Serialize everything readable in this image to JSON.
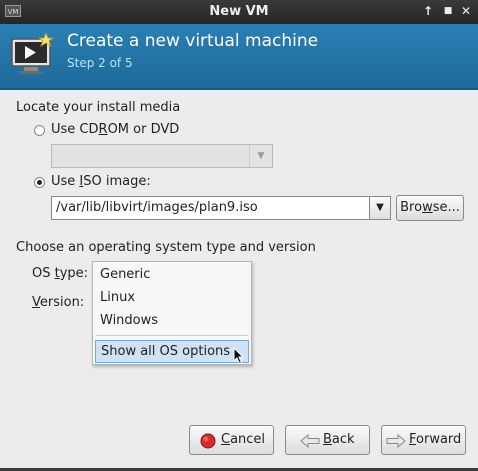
{
  "window": {
    "title": "New VM",
    "app_icon_text": "VM",
    "btn_up": "↑",
    "btn_max": "■",
    "btn_close": "✕"
  },
  "banner": {
    "title": "Create a new virtual machine",
    "step": "Step 2 of 5",
    "icon": "vm-monitor-icon",
    "bg_color": "#2276a9"
  },
  "media": {
    "heading": "Locate your install media",
    "cdrom_label_pre": "Use CD",
    "cdrom_label_ul": "R",
    "cdrom_label_post": "OM or DVD",
    "iso_label_pre": "Use ",
    "iso_label_ul": "I",
    "iso_label_post": "SO image:",
    "iso_path": "/var/lib/libvirt/images/plan9.iso",
    "browse_pre": "Bro",
    "browse_ul": "w",
    "browse_post": "se...",
    "selected": "iso"
  },
  "os": {
    "heading": "Choose an operating system type and version",
    "type_label_pre": "OS ",
    "type_label_ul": "t",
    "type_label_post": "ype:",
    "version_label_pre": "",
    "version_label_ul": "V",
    "version_label_post": "ersion:",
    "options": [
      "Generic",
      "Linux",
      "Windows"
    ],
    "show_all": "Show all OS options"
  },
  "buttons": {
    "cancel_ul": "C",
    "cancel_post": "ancel",
    "back_ul": "B",
    "back_post": "ack",
    "forward_ul": "F",
    "forward_post": "orward"
  }
}
